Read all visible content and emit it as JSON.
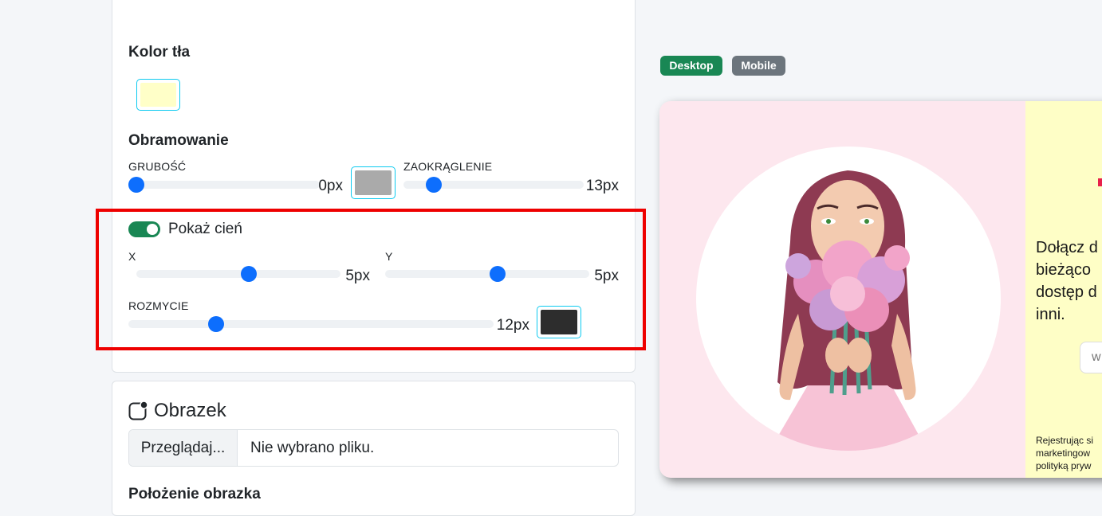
{
  "settings": {
    "bg_color_heading": "Kolor tła",
    "bg_color_value": "#ffffc8",
    "border_heading": "Obramowanie",
    "thickness_label": "GRUBOŚĆ",
    "thickness_value": "0px",
    "thickness_level": 0.0,
    "border_color_value": "#aaaaaa",
    "radius_label": "ZAOKRĄGLENIE",
    "radius_value": "13px",
    "radius_level": 0.17,
    "shadow_toggle_label": "Pokaż cień",
    "shadow_enabled": true,
    "x_label": "X",
    "x_value": "5px",
    "x_level": 0.55,
    "y_label": "Y",
    "y_value": "5px",
    "y_level": 0.55,
    "blur_label": "ROZMYCIE",
    "blur_value": "12px",
    "blur_level": 0.24,
    "shadow_color_value": "#2d2d2d"
  },
  "image_section": {
    "heading": "Obrazek",
    "browse_label": "Przeglądaj...",
    "no_file_text": "Nie wybrano pliku.",
    "position_heading": "Położenie obrazka"
  },
  "preview_toggle": {
    "desktop_label": "Desktop",
    "mobile_label": "Mobile",
    "desktop_color": "#198754",
    "mobile_color": "#6c757d"
  },
  "preview": {
    "text_lines": [
      "Dołącz d",
      "bieżąco",
      "dostęp d",
      "inni."
    ],
    "input_text": "w",
    "small_lines": [
      "Rejestrując si",
      "marketingow",
      "polityką pryw"
    ],
    "panel_color": "#fefec6",
    "image_bg": "#fde7ee"
  }
}
